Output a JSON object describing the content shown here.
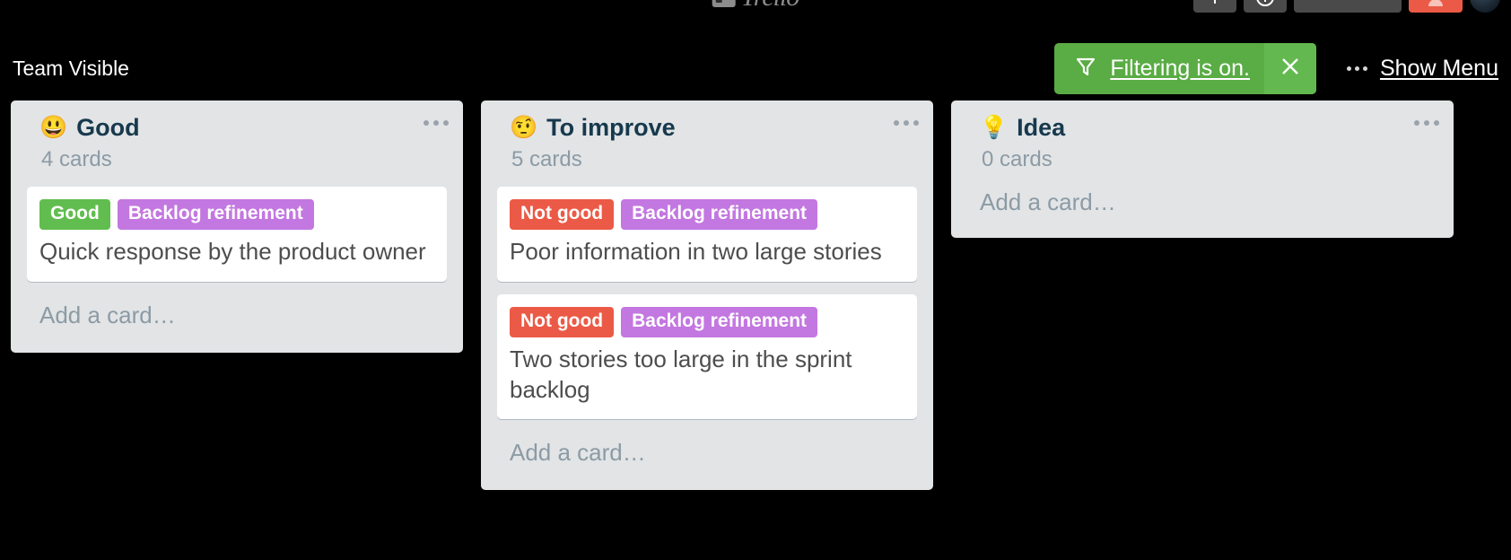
{
  "header": {
    "logo_text": "Trello",
    "logo_mark_icon": "trello-board-icon",
    "buttons": [
      {
        "icon": "plus-icon",
        "name": "add-button"
      },
      {
        "icon": "info-circle-icon",
        "name": "info-button"
      },
      {
        "icon": "bell-icon",
        "name": "notifications-button"
      },
      {
        "icon": "user-badge-icon",
        "name": "alert-badge-button"
      }
    ],
    "avatar_icon": "user-avatar"
  },
  "board_bar": {
    "visibility": "Team Visible",
    "filter": {
      "icon": "filter-funnel-icon",
      "label": "Filtering is on.",
      "clear_icon": "close-x-icon",
      "background_color": "#5aac44"
    },
    "menu": {
      "dots_icon": "ellipsis-horizontal-icon",
      "label": "Show Menu"
    }
  },
  "board": {
    "add_card_placeholder": "Add a card…",
    "list_menu_icon": "ellipsis-horizontal-icon",
    "lists": [
      {
        "emoji": "😃",
        "emoji_name": "grinning-face-emoji",
        "title": "Good",
        "count": "4 cards",
        "cards": [
          {
            "labels": [
              {
                "text": "Good",
                "color": "#61bd4f"
              },
              {
                "text": "Backlog refinement",
                "color": "#c377e0"
              }
            ],
            "title": "Quick response by the product owner"
          }
        ]
      },
      {
        "emoji": "🤨",
        "emoji_name": "face-with-raised-eyebrow-emoji",
        "title": "To improve",
        "count": "5 cards",
        "cards": [
          {
            "labels": [
              {
                "text": "Not good",
                "color": "#eb5a46"
              },
              {
                "text": "Backlog refinement",
                "color": "#c377e0"
              }
            ],
            "title": "Poor information in two large stories"
          },
          {
            "labels": [
              {
                "text": "Not good",
                "color": "#eb5a46"
              },
              {
                "text": "Backlog refinement",
                "color": "#c377e0"
              }
            ],
            "title": "Two stories too large in the sprint backlog"
          }
        ]
      },
      {
        "emoji": "💡",
        "emoji_name": "light-bulb-emoji",
        "title": "Idea",
        "count": "0 cards",
        "cards": []
      }
    ]
  }
}
